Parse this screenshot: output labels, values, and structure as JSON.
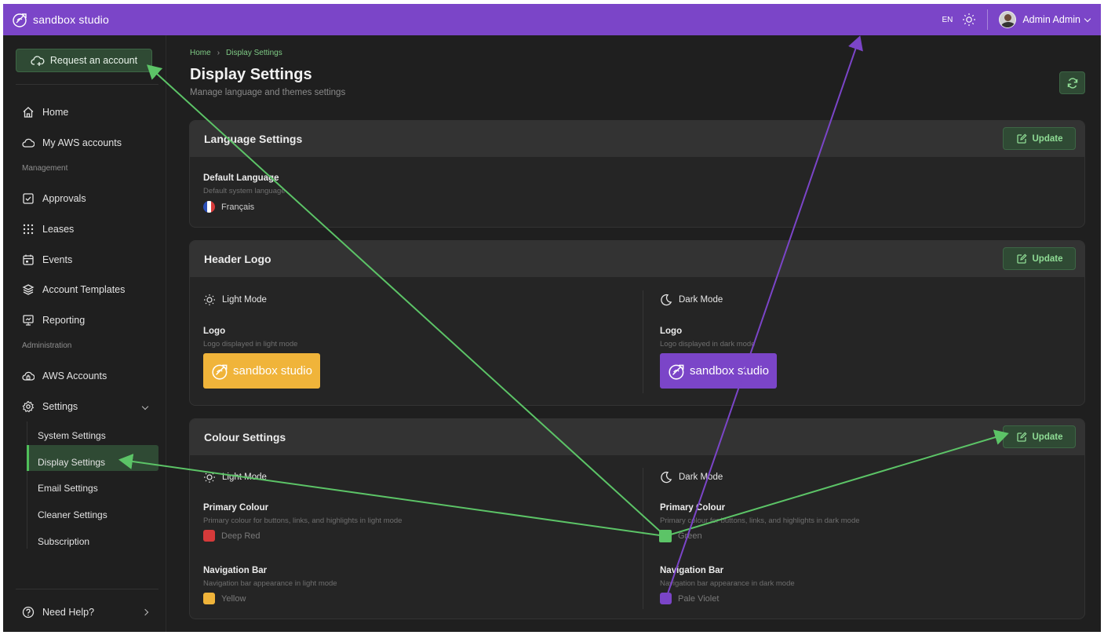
{
  "app": {
    "brand": "sandbox studio",
    "language": "EN",
    "user_name": "Admin Admin"
  },
  "sidebar": {
    "request_account": "Request an account",
    "items": [
      {
        "label": "Home",
        "icon": "home-icon"
      },
      {
        "label": "My AWS accounts",
        "icon": "cloud-icon"
      },
      {
        "label": "Approvals",
        "icon": "checkbox-icon"
      },
      {
        "label": "Leases",
        "icon": "grid-dots-icon"
      },
      {
        "label": "Events",
        "icon": "calendar-icon"
      },
      {
        "label": "Account Templates",
        "icon": "layers-icon"
      },
      {
        "label": "Reporting",
        "icon": "presentation-icon"
      },
      {
        "label": "AWS Accounts",
        "icon": "cloud-lock-icon"
      },
      {
        "label": "Settings",
        "icon": "gear-icon"
      }
    ],
    "sections": {
      "management": "Management",
      "administration": "Administration"
    },
    "settings_sub": [
      "System Settings",
      "Display Settings",
      "Email Settings",
      "Cleaner Settings",
      "Subscription"
    ],
    "help": "Need Help?"
  },
  "page": {
    "breadcrumb": [
      "Home",
      "Display Settings"
    ],
    "title": "Display Settings",
    "subtitle": "Manage language and themes settings"
  },
  "language_card": {
    "title": "Language Settings",
    "update": "Update",
    "field_label": "Default Language",
    "field_desc": "Default system language",
    "value": "Français"
  },
  "logo_card": {
    "title": "Header Logo",
    "update": "Update",
    "light_mode": "Light Mode",
    "dark_mode": "Dark Mode",
    "light_label": "Logo",
    "light_desc": "Logo displayed in light mode",
    "dark_label": "Logo",
    "dark_desc": "Logo displayed in dark mode",
    "logo_text": "sandbox studio"
  },
  "colour_card": {
    "title": "Colour Settings",
    "update": "Update",
    "light_mode": "Light Mode",
    "dark_mode": "Dark Mode",
    "light_primary_label": "Primary Colour",
    "light_primary_desc": "Primary colour for buttons, links, and highlights in light mode",
    "light_primary_value": "Deep Red",
    "dark_primary_label": "Primary Colour",
    "dark_primary_desc": "Primary colour for buttons, links, and highlights in dark mode",
    "dark_primary_value": "Green",
    "light_nav_label": "Navigation Bar",
    "light_nav_desc": "Navigation bar appearance in light mode",
    "light_nav_value": "Yellow",
    "dark_nav_label": "Navigation Bar",
    "dark_nav_desc": "Navigation bar appearance in dark mode",
    "dark_nav_value": "Pale Violet"
  },
  "colors": {
    "top_bar": "#7b45c8",
    "accent_green": "#4fbf5a",
    "deep_red": "#d63a3a",
    "green": "#4fbf5a",
    "yellow": "#f0b43a",
    "pale_violet": "#7b45c8"
  }
}
